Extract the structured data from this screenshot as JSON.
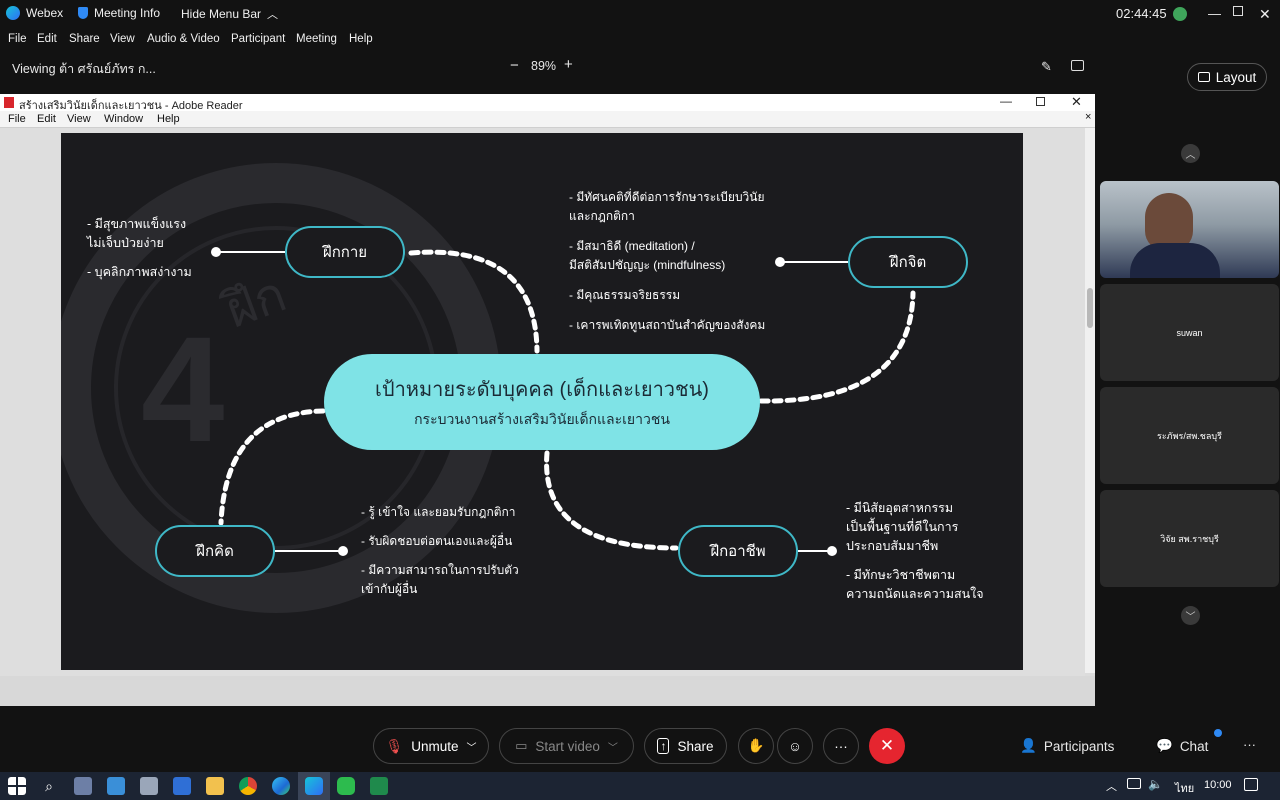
{
  "webex": {
    "app_name": "Webex",
    "meeting_info": "Meeting Info",
    "hide_menu": "Hide Menu Bar",
    "clock": "02:44:45",
    "menu": [
      "File",
      "Edit",
      "Share",
      "View",
      "Audio & Video",
      "Participant",
      "Meeting",
      "Help"
    ],
    "viewing": "Viewing ต้า ศรัณย์ภัทร ก...",
    "zoom": "89%",
    "zoom_minus": "−",
    "zoom_plus": "+",
    "layout_label": "Layout"
  },
  "reader": {
    "title": "สร้างเสริมวินัยเด็กและเยาวชน - Adobe Reader",
    "menu": [
      "File",
      "Edit",
      "View",
      "Window",
      "Help"
    ]
  },
  "slide": {
    "center_title": "เป้าหมายระดับบุคคล (เด็กและเยาวชน)",
    "center_subtitle": "กระบวนงานสร้างเสริมวินัยเด็กและเยาวชน",
    "body": {
      "label": "ฝึกกาย",
      "bullets": [
        "- มีสุขภาพแข็งแรง",
        "ไม่เจ็บป่วยง่าย",
        "- บุคลิกภาพสง่างาม"
      ]
    },
    "mind": {
      "label": "ฝึกจิต",
      "bullets": [
        "- มีทัศนคติที่ดีต่อการรักษาระเบียบวินัย",
        "และกฎกติกา",
        "- มีสมาธิดี (meditation) /",
        "มีสติสัมปชัญญะ (mindfulness)",
        "- มีคุณธรรมจริยธรรม",
        "- เคารพเทิดทูนสถาบันสำคัญของสังคม"
      ]
    },
    "think": {
      "label": "ฝึกคิด",
      "bullets": [
        "- รู้ เข้าใจ และยอมรับกฎกติกา",
        "- รับผิดชอบต่อตนเองและผู้อื่น",
        "-   มีความสามารถในการปรับตัว",
        "เข้ากับผู้อื่น"
      ]
    },
    "career": {
      "label": "ฝึกอาชีพ",
      "bullets": [
        "- มีนิสัยอุตสาหกรรม",
        "เป็นพื้นฐานที่ดีในการ",
        "ประกอบสัมมาชีพ",
        "- มีทักษะวิชาชีพตาม",
        "ความถนัดและความสนใจ"
      ]
    },
    "watermark_digit": "4",
    "watermark_word": "ฝึก"
  },
  "participants": [
    {
      "name": "",
      "has_video": true
    },
    {
      "name": "suwan",
      "has_video": false
    },
    {
      "name": "ระภัพร/สพ.ชลบุรี",
      "has_video": false
    },
    {
      "name": "วิจัย สพ.ราชบุรี",
      "has_video": false
    }
  ],
  "controls": {
    "unmute": "Unmute",
    "start_video": "Start video",
    "share": "Share",
    "more": "···",
    "participants": "Participants",
    "chat": "Chat",
    "overflow": "···"
  },
  "taskbar": {
    "lang": "ไทย",
    "time": "10:00"
  },
  "colors": {
    "accent_teal": "#3fb8c7",
    "center_fill": "#7fe3e6",
    "end_call": "#e5252f",
    "slide_bg": "#1b1b1e"
  }
}
